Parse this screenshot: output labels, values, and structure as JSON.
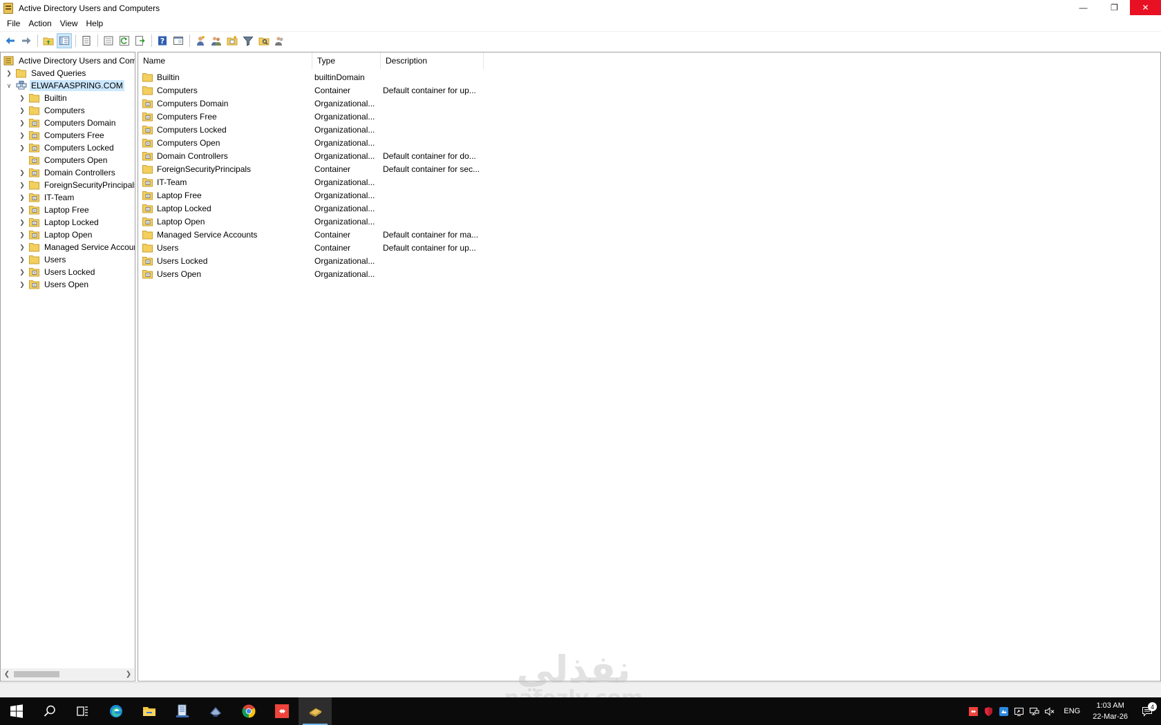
{
  "window": {
    "title": "Active Directory Users and Computers",
    "minimize_glyph": "—",
    "restore_glyph": "❐",
    "close_glyph": "✕"
  },
  "menubar": {
    "items": [
      {
        "label": "File"
      },
      {
        "label": "Action"
      },
      {
        "label": "View"
      },
      {
        "label": "Help"
      }
    ]
  },
  "toolbar": {
    "buttons": [
      "back-icon",
      "forward-icon",
      "up-folder-icon",
      "show-hide-tree-icon",
      "copy-icon",
      "properties-icon",
      "refresh-icon",
      "export-list-icon",
      "help-icon",
      "mmc-view-icon",
      "new-user-icon",
      "new-group-icon",
      "new-ou-icon",
      "filter-icon",
      "find-icon",
      "add-to-group-icon"
    ]
  },
  "tree": {
    "root": "Active Directory Users and Com",
    "saved_queries": "Saved Queries",
    "domain": "ELWAFAASPRING.COM",
    "children": [
      {
        "label": "Builtin",
        "kind": "container",
        "expandable": true
      },
      {
        "label": "Computers",
        "kind": "container",
        "expandable": true
      },
      {
        "label": "Computers Domain",
        "kind": "ou",
        "expandable": true
      },
      {
        "label": "Computers Free",
        "kind": "ou",
        "expandable": true
      },
      {
        "label": "Computers Locked",
        "kind": "ou",
        "expandable": true
      },
      {
        "label": "Computers Open",
        "kind": "ou",
        "expandable": false
      },
      {
        "label": "Domain Controllers",
        "kind": "ou",
        "expandable": true
      },
      {
        "label": "ForeignSecurityPrincipals",
        "kind": "container",
        "expandable": true
      },
      {
        "label": "IT-Team",
        "kind": "ou",
        "expandable": true
      },
      {
        "label": "Laptop Free",
        "kind": "ou",
        "expandable": true
      },
      {
        "label": "Laptop Locked",
        "kind": "ou",
        "expandable": true
      },
      {
        "label": "Laptop Open",
        "kind": "ou",
        "expandable": true
      },
      {
        "label": "Managed Service Accour",
        "kind": "container",
        "expandable": true
      },
      {
        "label": "Users",
        "kind": "container",
        "expandable": true
      },
      {
        "label": "Users Locked",
        "kind": "ou",
        "expandable": true
      },
      {
        "label": "Users Open",
        "kind": "ou",
        "expandable": true
      }
    ]
  },
  "list": {
    "columns": [
      "Name",
      "Type",
      "Description"
    ],
    "rows": [
      {
        "name": "Builtin",
        "type": "builtinDomain",
        "description": "",
        "kind": "container"
      },
      {
        "name": "Computers",
        "type": "Container",
        "description": "Default container for up...",
        "kind": "container"
      },
      {
        "name": "Computers Domain",
        "type": "Organizational...",
        "description": "",
        "kind": "ou"
      },
      {
        "name": "Computers Free",
        "type": "Organizational...",
        "description": "",
        "kind": "ou"
      },
      {
        "name": "Computers Locked",
        "type": "Organizational...",
        "description": "",
        "kind": "ou"
      },
      {
        "name": "Computers Open",
        "type": "Organizational...",
        "description": "",
        "kind": "ou"
      },
      {
        "name": "Domain Controllers",
        "type": "Organizational...",
        "description": "Default container for do...",
        "kind": "ou"
      },
      {
        "name": "ForeignSecurityPrincipals",
        "type": "Container",
        "description": "Default container for sec...",
        "kind": "container"
      },
      {
        "name": "IT-Team",
        "type": "Organizational...",
        "description": "",
        "kind": "ou"
      },
      {
        "name": "Laptop Free",
        "type": "Organizational...",
        "description": "",
        "kind": "ou"
      },
      {
        "name": "Laptop Locked",
        "type": "Organizational...",
        "description": "",
        "kind": "ou"
      },
      {
        "name": "Laptop Open",
        "type": "Organizational...",
        "description": "",
        "kind": "ou"
      },
      {
        "name": "Managed Service Accounts",
        "type": "Container",
        "description": "Default container for ma...",
        "kind": "container"
      },
      {
        "name": "Users",
        "type": "Container",
        "description": "Default container for up...",
        "kind": "container"
      },
      {
        "name": "Users Locked",
        "type": "Organizational...",
        "description": "",
        "kind": "ou"
      },
      {
        "name": "Users Open",
        "type": "Organizational...",
        "description": "",
        "kind": "ou"
      }
    ]
  },
  "taskbar": {
    "apps": [
      "start-icon",
      "search-icon",
      "task-view-icon",
      "edge-icon",
      "file-explorer-icon",
      "server-manager-icon",
      "network-icon",
      "chrome-icon",
      "anydesk-icon",
      "ad-users-computers-icon"
    ]
  },
  "tray": {
    "language": "ENG",
    "time": "1:03 AM",
    "date": "22-Mar-26",
    "notification_count": "4"
  },
  "watermark": {
    "arabic": "نفذلي",
    "url": "nafezly.com"
  },
  "colors": {
    "folder": "#f3cf5e",
    "folder_border": "#c9a030",
    "selection": "#cce8ff",
    "close_button": "#e81123",
    "taskbar": "#0b0b0b"
  }
}
